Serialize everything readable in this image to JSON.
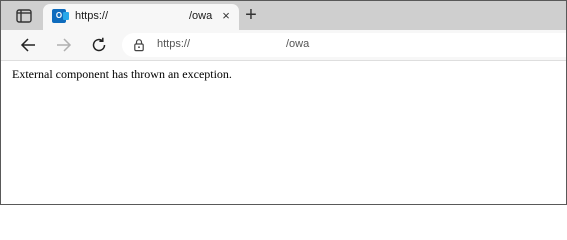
{
  "browser": {
    "tab": {
      "icon": "outlook-icon",
      "icon_letter": "O",
      "title_left": "https://",
      "title_right": "/owa",
      "close_glyph": "×"
    },
    "new_tab_glyph": "+",
    "toolbar": {
      "back_icon": "back-arrow-icon",
      "forward_icon": "forward-arrow-icon",
      "refresh_icon": "refresh-icon",
      "lock_icon": "lock-icon"
    },
    "address": {
      "url_left": "https://",
      "url_right": "/owa"
    }
  },
  "page": {
    "message": "External component has thrown an exception."
  },
  "colors": {
    "tabstrip_bg": "#cfcfcf",
    "tab_bg": "#f7f7f7",
    "outlook_blue": "#0f6cbd"
  }
}
